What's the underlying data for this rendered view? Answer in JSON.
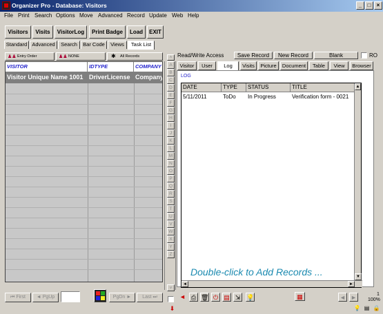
{
  "window": {
    "title": "Organizer Pro - Database: Visitors"
  },
  "menu": [
    "File",
    "Print",
    "Search",
    "Options",
    "Move",
    "Advanced",
    "Record",
    "Update",
    "Web",
    "Help"
  ],
  "toolbar": {
    "visitors": "Visitors",
    "visits": "Visits",
    "visitorlog": "VisitorLog",
    "printbadge": "Print Badge",
    "load": "Load",
    "exit": "EXIT"
  },
  "left_tabs": [
    "Standard",
    "Advanced",
    "Search",
    "Bar Code",
    "Views",
    "Task List"
  ],
  "sort": {
    "entry_order": "Entry Order",
    "none": "NONE",
    "all_records": "All Records"
  },
  "grid": {
    "columns": [
      "VISITOR",
      "IDTYPE",
      "COMPANY"
    ],
    "rows": [
      [
        "Visitor Unique Name 1001",
        "DriverLicense",
        "Company"
      ]
    ]
  },
  "alpha": [
    "A",
    "B",
    "C",
    "D",
    "E",
    "F",
    "G",
    "H",
    "I",
    "J",
    "K",
    "L",
    "M",
    "N",
    "O",
    "P",
    "Q",
    "R",
    "S",
    "T",
    "U",
    "V",
    "W",
    "X",
    "Y",
    "Z"
  ],
  "right_header": {
    "access": "Read/Write Access",
    "save": "Save Record",
    "new": "New Record",
    "blank": "Blank",
    "ro": "RO"
  },
  "right_tabs": [
    "Visitor",
    "User",
    "Log",
    "Visits",
    "Picture",
    "Document",
    "Table",
    "View",
    "Browser"
  ],
  "log": {
    "label": "LOG",
    "columns": [
      "DATE",
      "TYPE",
      "STATUS",
      "TITLE"
    ],
    "rows": [
      [
        "5/11/2011",
        "ToDo",
        "In Progress",
        "Verification form - 0021"
      ]
    ],
    "hint": "Double-click to Add Records ..."
  },
  "nav": {
    "first": "First",
    "pgup": "PgUp",
    "pgdn": "PgDn",
    "last": "Last"
  },
  "status": {
    "page": "1",
    "zoom": "100%"
  }
}
